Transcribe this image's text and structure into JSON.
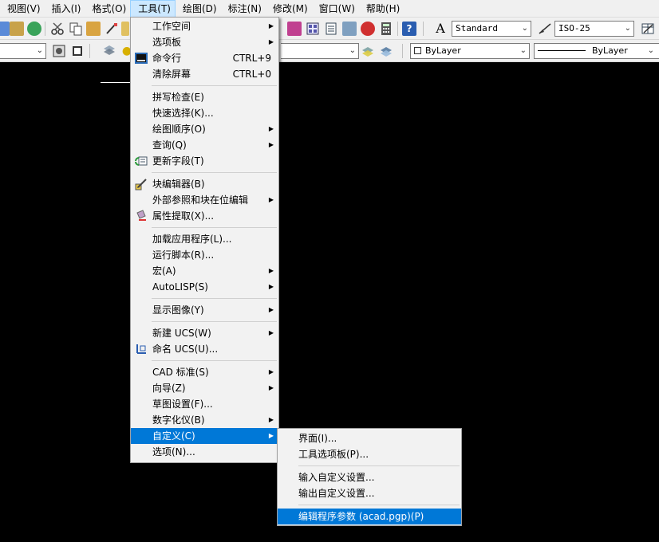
{
  "menubar": {
    "items": [
      "视图(V)",
      "插入(I)",
      "格式(O)",
      "工具(T)",
      "绘图(D)",
      "标注(N)",
      "修改(M)",
      "窗口(W)",
      "帮助(H)"
    ]
  },
  "toolbar": {
    "text_style": "Standard",
    "dim_style": "ISO-25",
    "color": "ByLayer",
    "linetype": "ByLayer"
  },
  "tools_menu": {
    "items": [
      {
        "label": "工作空间",
        "submenu": true
      },
      {
        "label": "选项板",
        "submenu": true
      },
      {
        "label": "命令行",
        "shortcut": "CTRL+9",
        "icon": "command-line-icon"
      },
      {
        "label": "清除屏幕",
        "shortcut": "CTRL+0"
      },
      {
        "label": "拼写检查(E)"
      },
      {
        "label": "快速选择(K)..."
      },
      {
        "label": "绘图顺序(O)",
        "submenu": true
      },
      {
        "label": "查询(Q)",
        "submenu": true
      },
      {
        "label": "更新字段(T)",
        "icon": "update-field-icon"
      },
      {
        "label": "块编辑器(B)",
        "icon": "block-editor-icon"
      },
      {
        "label": "外部参照和块在位编辑",
        "submenu": true
      },
      {
        "label": "属性提取(X)...",
        "icon": "attribute-extract-icon"
      },
      {
        "label": "加载应用程序(L)..."
      },
      {
        "label": "运行脚本(R)..."
      },
      {
        "label": "宏(A)",
        "submenu": true
      },
      {
        "label": "AutoLISP(S)",
        "submenu": true
      },
      {
        "label": "显示图像(Y)",
        "submenu": true
      },
      {
        "label": "新建 UCS(W)",
        "submenu": true
      },
      {
        "label": "命名 UCS(U)...",
        "icon": "named-ucs-icon"
      },
      {
        "label": "CAD 标准(S)",
        "submenu": true
      },
      {
        "label": "向导(Z)",
        "submenu": true
      },
      {
        "label": "草图设置(F)..."
      },
      {
        "label": "数字化仪(B)",
        "submenu": true
      },
      {
        "label": "自定义(C)",
        "submenu": true
      },
      {
        "label": "选项(N)..."
      }
    ]
  },
  "customize_menu": {
    "items": [
      {
        "label": "界面(I)..."
      },
      {
        "label": "工具选项板(P)..."
      },
      {
        "label": "输入自定义设置..."
      },
      {
        "label": "输出自定义设置..."
      },
      {
        "label": "编辑程序参数 (acad.pgp)(P)"
      }
    ]
  },
  "colors": {
    "highlight": "#0078d7",
    "canvas": "#000000",
    "menu_bg": "#f2f2f2"
  }
}
